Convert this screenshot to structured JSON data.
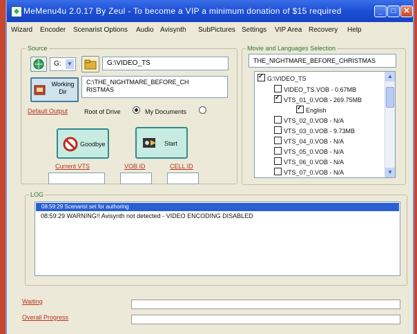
{
  "window": {
    "title": "MeMenu4u 2.0.17 By Zeul - To become a VIP a minimum donation of $15 required",
    "accent_color": "#1c4fd6",
    "minimize_icon": "minimize-icon",
    "maximize_icon": "maximize-icon",
    "close_icon": "close-icon"
  },
  "menu": [
    "Wizard",
    "Encoder",
    "Scenarist Options",
    "Audio",
    "Avisynth",
    "SubPictures",
    "Settings",
    "VIP Area",
    "Recovery",
    "Help"
  ],
  "source": {
    "group_label": "Source",
    "drive_value": "G:",
    "folder_path": "G:\\VIDEO_TS",
    "working_dir_label": "Working Dir",
    "working_dir_path": "C:\\THE_NIGHTMARE_BEFORE_CHRISTMAS",
    "default_output_label": "Default Output",
    "root_of_drive_label": "Root of Drive",
    "my_documents_label": "My Documents"
  },
  "buttons": {
    "goodbye_label": "Goodbye",
    "start_label": "Start"
  },
  "ids": {
    "current_vts_label": "Current VTS",
    "vob_id_label": "VOB ID",
    "cell_id_label": "CELL ID"
  },
  "movie": {
    "group_label": "Movie and Languages Selection",
    "title_value": "THE_NIGHTMARE_BEFORE_CHRISTMAS",
    "tree": {
      "root": "G:\\VIDEO_TS",
      "items": [
        {
          "label": "VIDEO_TS.VOB - 0.67MB",
          "checked": false
        },
        {
          "label": "VTS_01_0.VOB - 269.75MB",
          "checked": true
        },
        {
          "label": "English",
          "checked": true
        },
        {
          "label": "VTS_02_0.VOB - N/A",
          "checked": false
        },
        {
          "label": "VTS_03_0.VOB - 9.73MB",
          "checked": false
        },
        {
          "label": "VTS_04_0.VOB - N/A",
          "checked": false
        },
        {
          "label": "VTS_05_0.VOB - N/A",
          "checked": false
        },
        {
          "label": "VTS_06_0.VOB - N/A",
          "checked": false
        },
        {
          "label": "VTS_07_0.VOB - N/A",
          "checked": false
        }
      ]
    }
  },
  "log": {
    "group_label": "LOG",
    "selected_line": "08:59:29 Scenarist set for authoring",
    "line": "08:59:29 WARNING!! Avisynth not detected - VIDEO ENCODING DISABLED"
  },
  "status": {
    "waiting_label": "Waiting",
    "overall_label": "Overall Progress"
  }
}
